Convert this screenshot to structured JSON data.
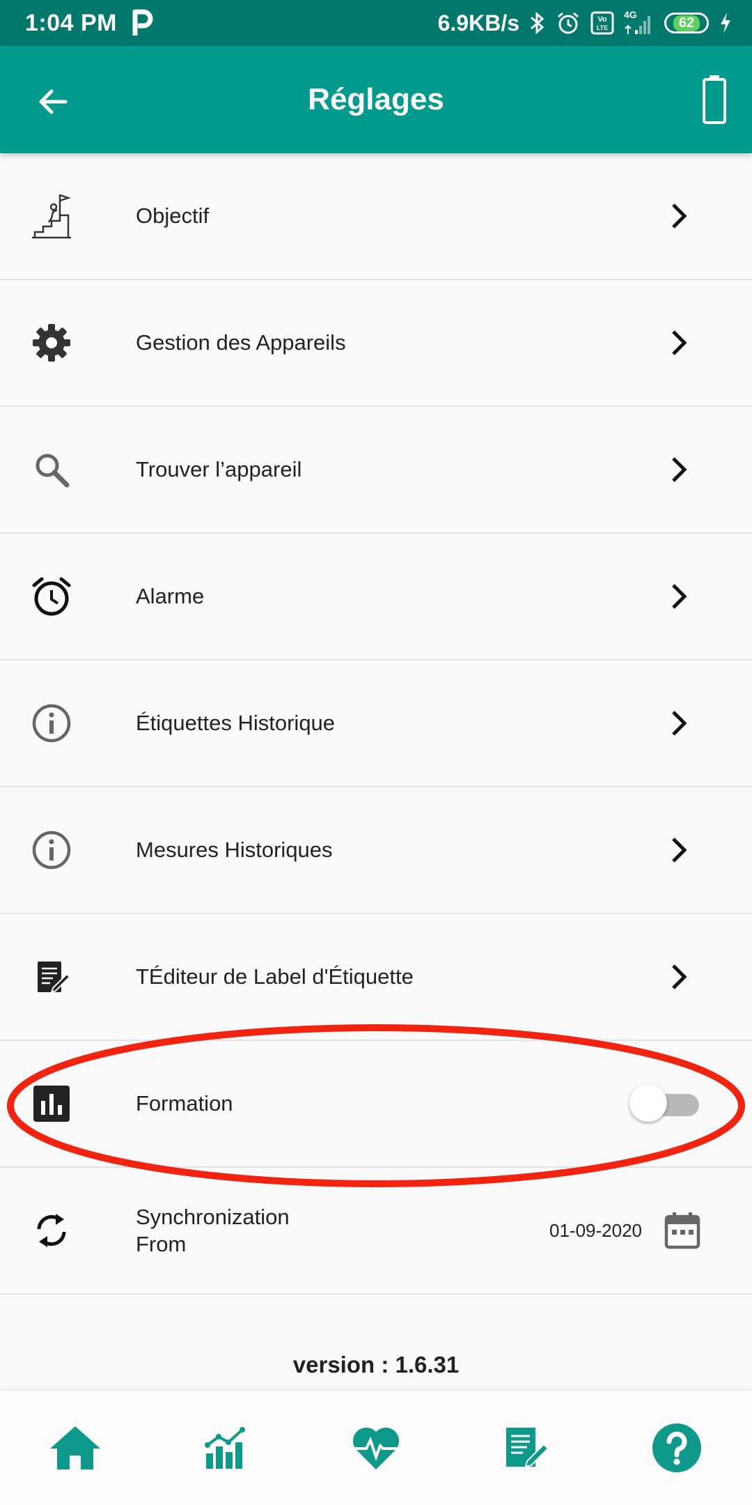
{
  "status_bar": {
    "time": "1:04 PM",
    "network_speed": "6.9KB/s",
    "network_type": "4G",
    "volte_label": "Vo LTE",
    "battery_level": "62",
    "icons": [
      "p-app-icon",
      "bluetooth-icon",
      "alarm-icon",
      "volte-icon",
      "signal-icon",
      "battery-icon",
      "charging-icon"
    ]
  },
  "app_bar": {
    "title": "Réglages",
    "back_icon": "arrow-back-icon",
    "action_icon": "battery-full-icon"
  },
  "settings": {
    "items": [
      {
        "label": "Objectif",
        "icon": "goal-climb-icon"
      },
      {
        "label": "Gestion des Appareils",
        "icon": "gear-icon"
      },
      {
        "label": "Trouver l’appareil",
        "icon": "search-icon"
      },
      {
        "label": "Alarme",
        "icon": "alarm-clock-icon"
      },
      {
        "label": "Étiquettes Historique",
        "icon": "info-icon"
      },
      {
        "label": "Mesures Historiques",
        "icon": "info-icon"
      },
      {
        "label": "TÉditeur de Label d'Étiquette",
        "icon": "edit-document-icon"
      }
    ],
    "formation": {
      "label": "Formation",
      "icon": "bar-chart-icon",
      "toggle_on": false
    },
    "sync": {
      "label_line1": "Synchronization",
      "label_line2": "From",
      "date": "01-09-2020",
      "icon": "sync-icon"
    }
  },
  "version_text": "version : 1.6.31",
  "bottom_nav": {
    "items": [
      {
        "name": "home-icon"
      },
      {
        "name": "statistics-icon"
      },
      {
        "name": "heart-rate-icon"
      },
      {
        "name": "notes-icon"
      },
      {
        "name": "help-icon"
      }
    ]
  },
  "colors": {
    "status_bar": "#00786c",
    "app_bar": "#009b8d",
    "accent": "#0e9a8a",
    "highlight": "#f2230f",
    "background": "#fafafa"
  }
}
